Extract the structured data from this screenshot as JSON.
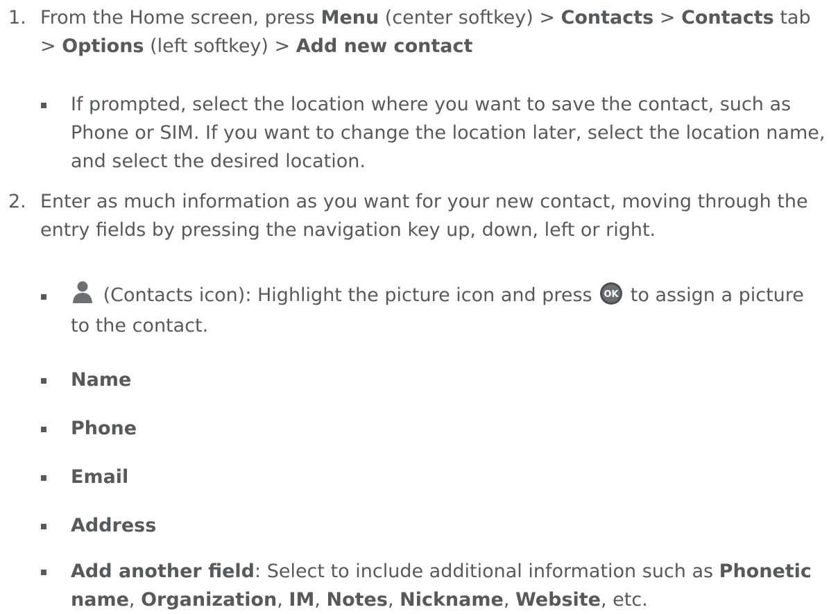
{
  "steps": [
    {
      "number": "1.",
      "segments": [
        {
          "t": "From the Home screen, press ",
          "b": false
        },
        {
          "t": "Menu",
          "b": true
        },
        {
          "t": " (center softkey) > ",
          "b": false
        },
        {
          "t": "Contacts",
          "b": true
        },
        {
          "t": " > ",
          "b": false
        },
        {
          "t": "Contacts",
          "b": true
        },
        {
          "t": " tab > ",
          "b": false
        },
        {
          "t": "Options",
          "b": true
        },
        {
          "t": " (left softkey) > ",
          "b": false
        },
        {
          "t": "Add new contact",
          "b": true
        }
      ],
      "bullets": [
        {
          "segments": [
            {
              "t": "If prompted, select the location where you want to save the contact, such as Phone or SIM. If you want to change the location later, select the location name, and select the desired location.",
              "b": false
            }
          ]
        }
      ]
    },
    {
      "number": "2.",
      "segments": [
        {
          "t": "Enter as much information as you want for your new contact, moving through the entry fields by pressing the navigation key up, down, left or right.",
          "b": false
        }
      ],
      "bullets": [
        {
          "segments": [
            {
              "icon": "contacts-person-icon"
            },
            {
              "t": " (Contacts icon): Highlight the picture icon and press ",
              "b": false
            },
            {
              "icon": "ok-key-icon"
            },
            {
              "t": " to assign a picture to the contact.",
              "b": false
            }
          ]
        },
        {
          "segments": [
            {
              "t": "Name",
              "b": true
            }
          ]
        },
        {
          "segments": [
            {
              "t": "Phone",
              "b": true
            }
          ]
        },
        {
          "segments": [
            {
              "t": "Email",
              "b": true
            }
          ]
        },
        {
          "segments": [
            {
              "t": "Address",
              "b": true
            }
          ]
        },
        {
          "segments": [
            {
              "t": "Add another field",
              "b": true
            },
            {
              "t": ": Select to include additional information such as ",
              "b": false
            },
            {
              "t": "Phonetic name",
              "b": true
            },
            {
              "t": ", ",
              "b": false
            },
            {
              "t": "Organization",
              "b": true
            },
            {
              "t": ", ",
              "b": false
            },
            {
              "t": "IM",
              "b": true
            },
            {
              "t": ", ",
              "b": false
            },
            {
              "t": "Notes",
              "b": true
            },
            {
              "t": ", ",
              "b": false
            },
            {
              "t": "Nickname",
              "b": true
            },
            {
              "t": ", ",
              "b": false
            },
            {
              "t": "Website",
              "b": true
            },
            {
              "t": ", etc.",
              "b": false
            }
          ]
        }
      ]
    }
  ],
  "colors": {
    "text": "#58595b",
    "icon": "#6d6e71"
  }
}
